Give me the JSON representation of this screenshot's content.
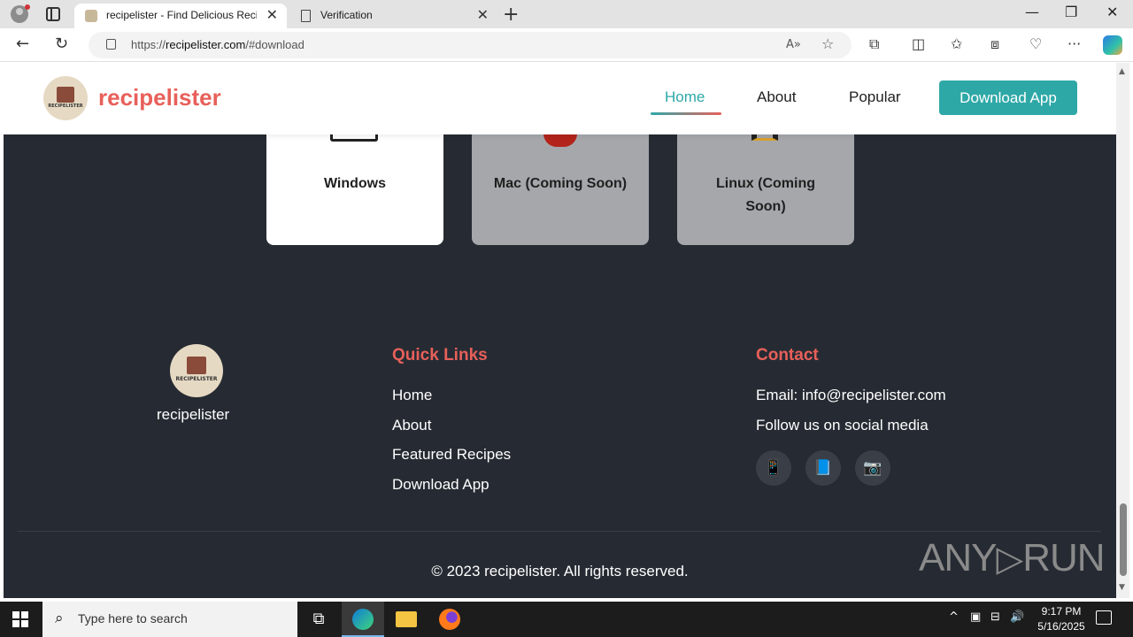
{
  "browser": {
    "tabs": [
      {
        "title": "recipelister - Find Delicious Recip",
        "close": "✕"
      },
      {
        "title": "Verification",
        "close": "✕"
      }
    ],
    "new_tab": "+",
    "window_controls": {
      "minimize": "—",
      "restore": "❐",
      "close": "✕"
    },
    "nav": {
      "back": "←",
      "refresh": "↻"
    },
    "url_prefix": "https://",
    "url_host": "recipelister.com",
    "url_path": "/#download",
    "toolbar_icons": [
      "read-aloud-icon",
      "favorite-star-icon",
      "extensions-icon",
      "split-screen-icon",
      "favorites-icon",
      "collections-icon",
      "browser-essentials-icon",
      "more-icon",
      "copilot-icon"
    ],
    "glyphs": {
      "read_aloud": "A»",
      "favorite": "☆",
      "extensions": "⧉",
      "split": "◫",
      "favorites": "✩",
      "collections": "⧈",
      "essentials": "♡",
      "more": "···"
    }
  },
  "site": {
    "brand": "recipelister",
    "logo_text": "RECIPELISTER",
    "accent": "#e8605a",
    "teal": "#2ea8a7",
    "nav": [
      {
        "label": "Home",
        "active": true
      },
      {
        "label": "About",
        "active": false
      },
      {
        "label": "Popular",
        "active": false
      }
    ],
    "download_button": "Download App"
  },
  "download_cards": [
    {
      "label": "Windows",
      "icon": "laptop-icon"
    },
    {
      "label": "Mac (Coming Soon)",
      "icon": "apple-icon"
    },
    {
      "label": "Linux (Coming Soon)",
      "icon": "penguin-icon"
    }
  ],
  "footer": {
    "brand": "recipelister",
    "quick_links_heading": "Quick Links",
    "quick_links": [
      "Home",
      "About",
      "Featured Recipes",
      "Download App"
    ],
    "contact_heading": "Contact",
    "email": "Email: info@recipelister.com",
    "follow": "Follow us on social media",
    "social": [
      {
        "icon": "phone-icon",
        "glyph": "📱"
      },
      {
        "icon": "book-icon",
        "glyph": "📘"
      },
      {
        "icon": "camera-icon",
        "glyph": "📷"
      }
    ],
    "copyright": "© 2023 recipelister. All rights reserved."
  },
  "watermark": {
    "left": "ANY",
    "right": "RUN",
    "play": "▷"
  },
  "taskbar": {
    "search_placeholder": "Type here to search",
    "search_glyph": "⌕",
    "task_view_glyph": "⧉",
    "time": "9:17 PM",
    "date": "5/16/2025",
    "tray_glyphs": {
      "chevron": "^",
      "meet": "▣",
      "network": "⊟",
      "volume": "🔊"
    }
  }
}
